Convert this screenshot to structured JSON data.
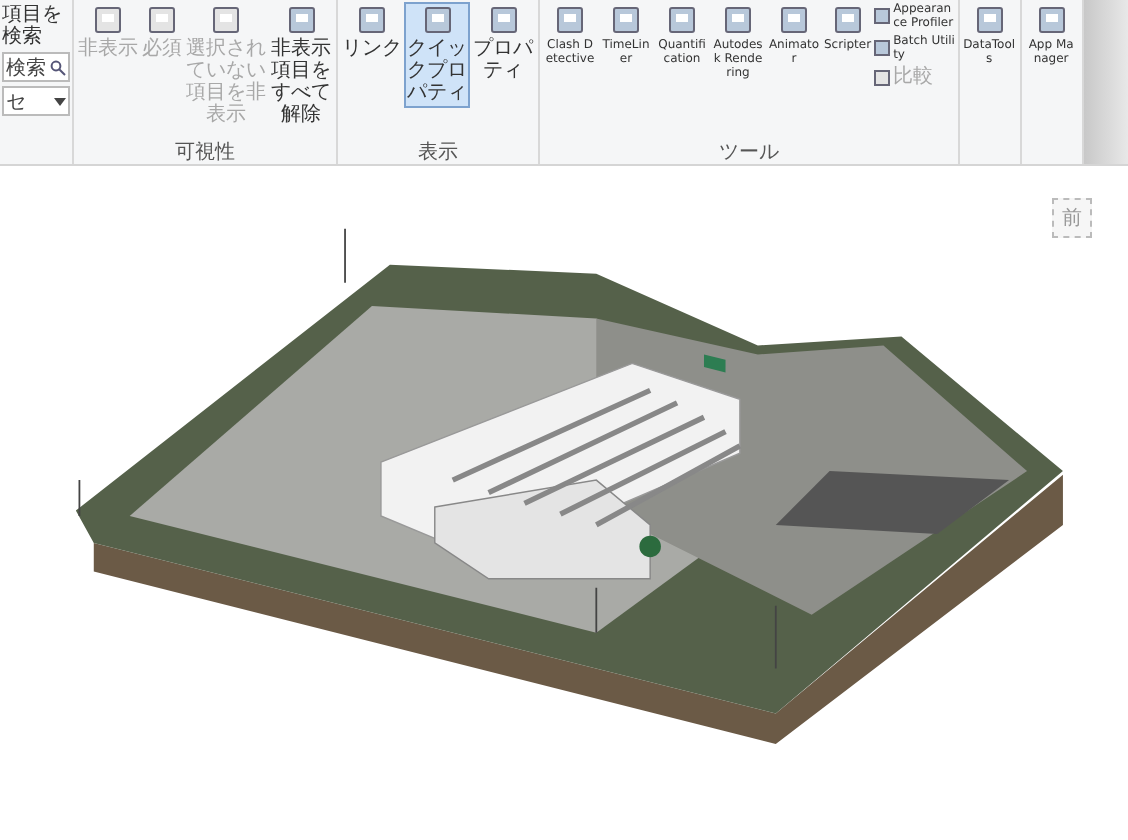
{
  "quick_find": {
    "label": "項目を検索",
    "field_value": "検索",
    "select_value": "セ"
  },
  "groups": [
    {
      "label": "可視性",
      "buttons": [
        {
          "kind": "large",
          "label": "非表示",
          "disabled": true
        },
        {
          "kind": "large",
          "label": "必須",
          "disabled": true
        },
        {
          "kind": "large",
          "label": "選択されていない項目を非表示",
          "disabled": true
        },
        {
          "kind": "large",
          "label": "非表示項目をすべて解除",
          "disabled": false
        }
      ]
    },
    {
      "label": "表示",
      "buttons": [
        {
          "kind": "large",
          "label": "リンク",
          "selected": false
        },
        {
          "kind": "large",
          "label": "クイックプロパティ",
          "selected": true
        },
        {
          "kind": "large",
          "label": "プロパティ",
          "selected": false
        }
      ]
    },
    {
      "label": "ツール",
      "buttons": [
        {
          "kind": "large",
          "label": "Clash Detective",
          "disabled": false
        },
        {
          "kind": "large",
          "label": "TimeLiner",
          "disabled": false
        },
        {
          "kind": "large",
          "label": "Quantification",
          "disabled": false
        },
        {
          "kind": "large",
          "label": "Autodesk Rendering",
          "disabled": false
        },
        {
          "kind": "large",
          "label": "Animator",
          "disabled": false
        },
        {
          "kind": "large",
          "label": "Scripter",
          "disabled": false
        },
        {
          "kind": "small",
          "label": "Appearance Profiler",
          "disabled": false
        },
        {
          "kind": "small",
          "label": "Batch Utility",
          "disabled": false
        },
        {
          "kind": "small",
          "label": "比較",
          "disabled": true
        }
      ]
    },
    {
      "buttons": [
        {
          "kind": "large",
          "label": "DataTools"
        }
      ]
    },
    {
      "buttons": [
        {
          "kind": "large",
          "label": "App Manager"
        }
      ]
    }
  ],
  "viewcube": {
    "face": "前"
  }
}
